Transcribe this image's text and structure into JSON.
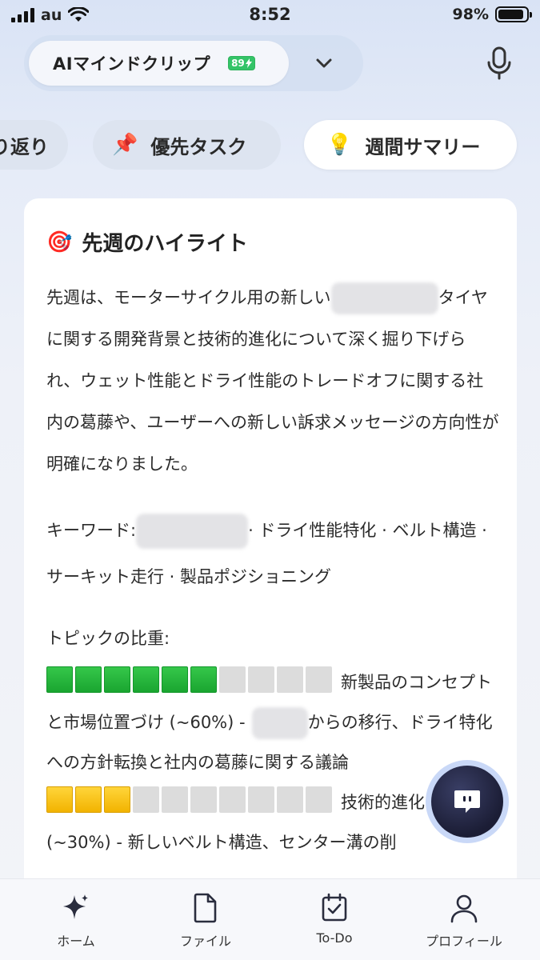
{
  "status_bar": {
    "carrier": "au",
    "time": "8:52",
    "battery": "98%"
  },
  "header": {
    "app_title": "AIマインドクリップ",
    "badge": "89",
    "chevron_icon": "chevron-down-icon",
    "mic_icon": "microphone-icon"
  },
  "chips": [
    {
      "label": "り返り"
    },
    {
      "label": "優先タスク",
      "emoji": "📌"
    },
    {
      "label": "週間サマリー",
      "emoji": "💡",
      "selected": true
    }
  ],
  "card": {
    "title_emoji": "🎯",
    "title": "先週のハイライト",
    "para_part1": "先週は、モーターサイクル用の新しい",
    "para_part2": "タイヤに関する開発背景と技術的進化について深く掘り下げられ、ウェット性能とドライ性能のトレードオフに関する社内の葛藤や、ユーザーへの新しい訴求メッセージの方向性が明確になりました。",
    "keywords_label": "キーワード:",
    "keywords_rest": "· ドライ性能特化 · ベルト構造 · サーキット走行 · 製品ポジショニング",
    "topics_heading": "トピックの比重:",
    "topic1_part1": "新製品のコンセプトと市場位置づけ (~60%) -",
    "topic1_part2": "からの移行、ドライ特化への方針転換と社内の葛藤に関する議論",
    "topic2_part1": "技術的進化の評価 (~30%) - 新しいベルト構造、センター溝の削",
    "topic1_filled": 6,
    "topic2_filled": 3,
    "total_blocks": 10,
    "topic1_color": "#1aa530",
    "topic2_color": "#f2b300"
  },
  "fab": {
    "icon": "chat-icon"
  },
  "bottom_nav": [
    {
      "label": "ホーム",
      "icon": "sparkle-icon"
    },
    {
      "label": "ファイル",
      "icon": "file-icon"
    },
    {
      "label": "To-Do",
      "icon": "calendar-check-icon"
    },
    {
      "label": "プロフィール",
      "icon": "person-icon"
    }
  ]
}
